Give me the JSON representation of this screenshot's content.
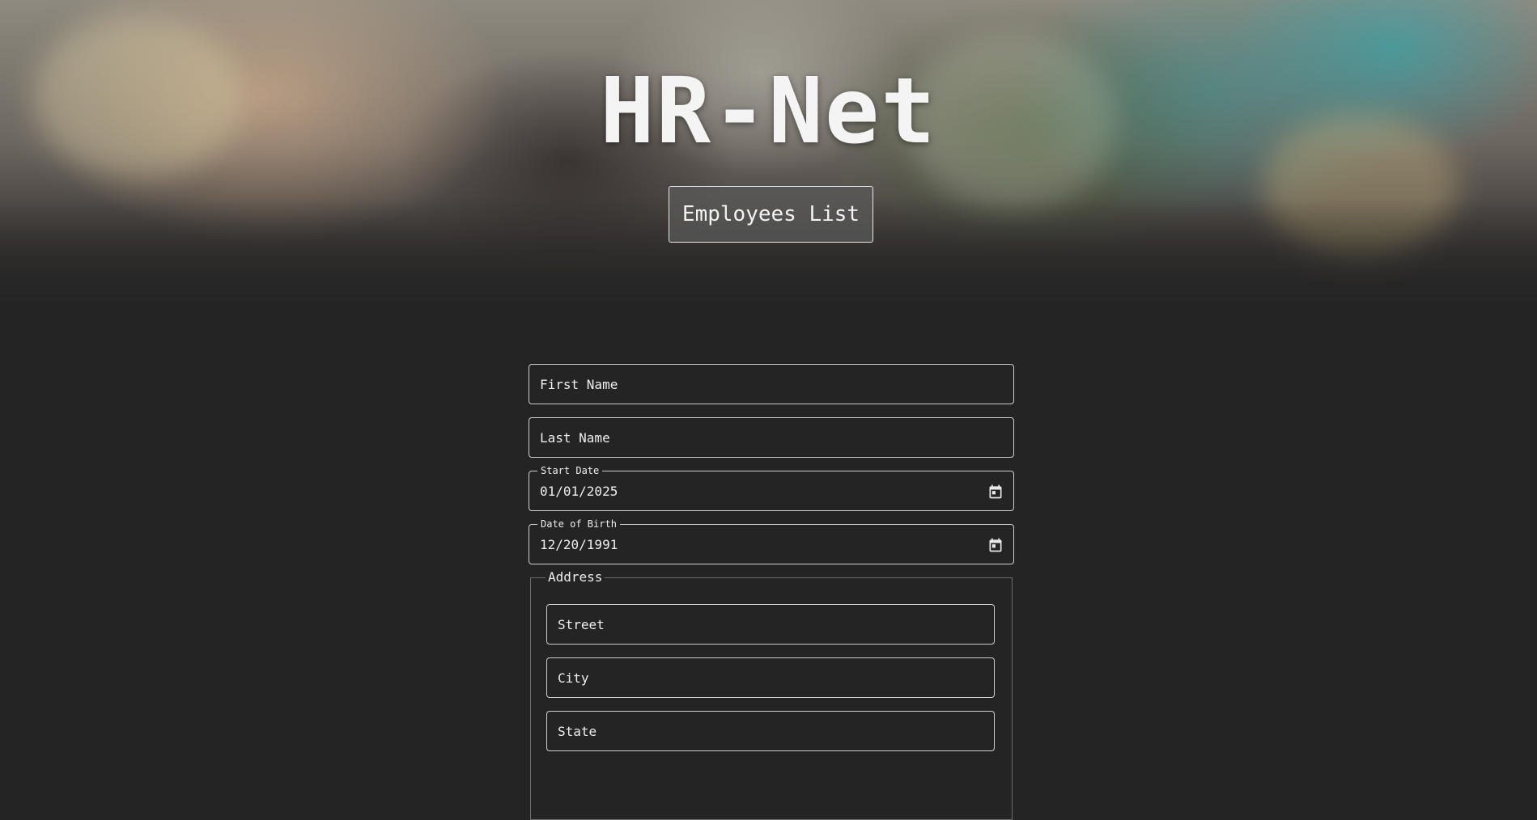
{
  "header": {
    "title": "HR-Net",
    "employees_list_label": "Employees List"
  },
  "form": {
    "first_name_placeholder": "First Name",
    "last_name_placeholder": "Last Name",
    "start_date": {
      "label": "Start Date",
      "value": "01/01/2025",
      "icon": "calendar-icon"
    },
    "date_of_birth": {
      "label": "Date of Birth",
      "value": "12/20/1991",
      "icon": "calendar-icon"
    },
    "address": {
      "legend": "Address",
      "street_placeholder": "Street",
      "city_placeholder": "City",
      "state_placeholder": "State"
    }
  }
}
